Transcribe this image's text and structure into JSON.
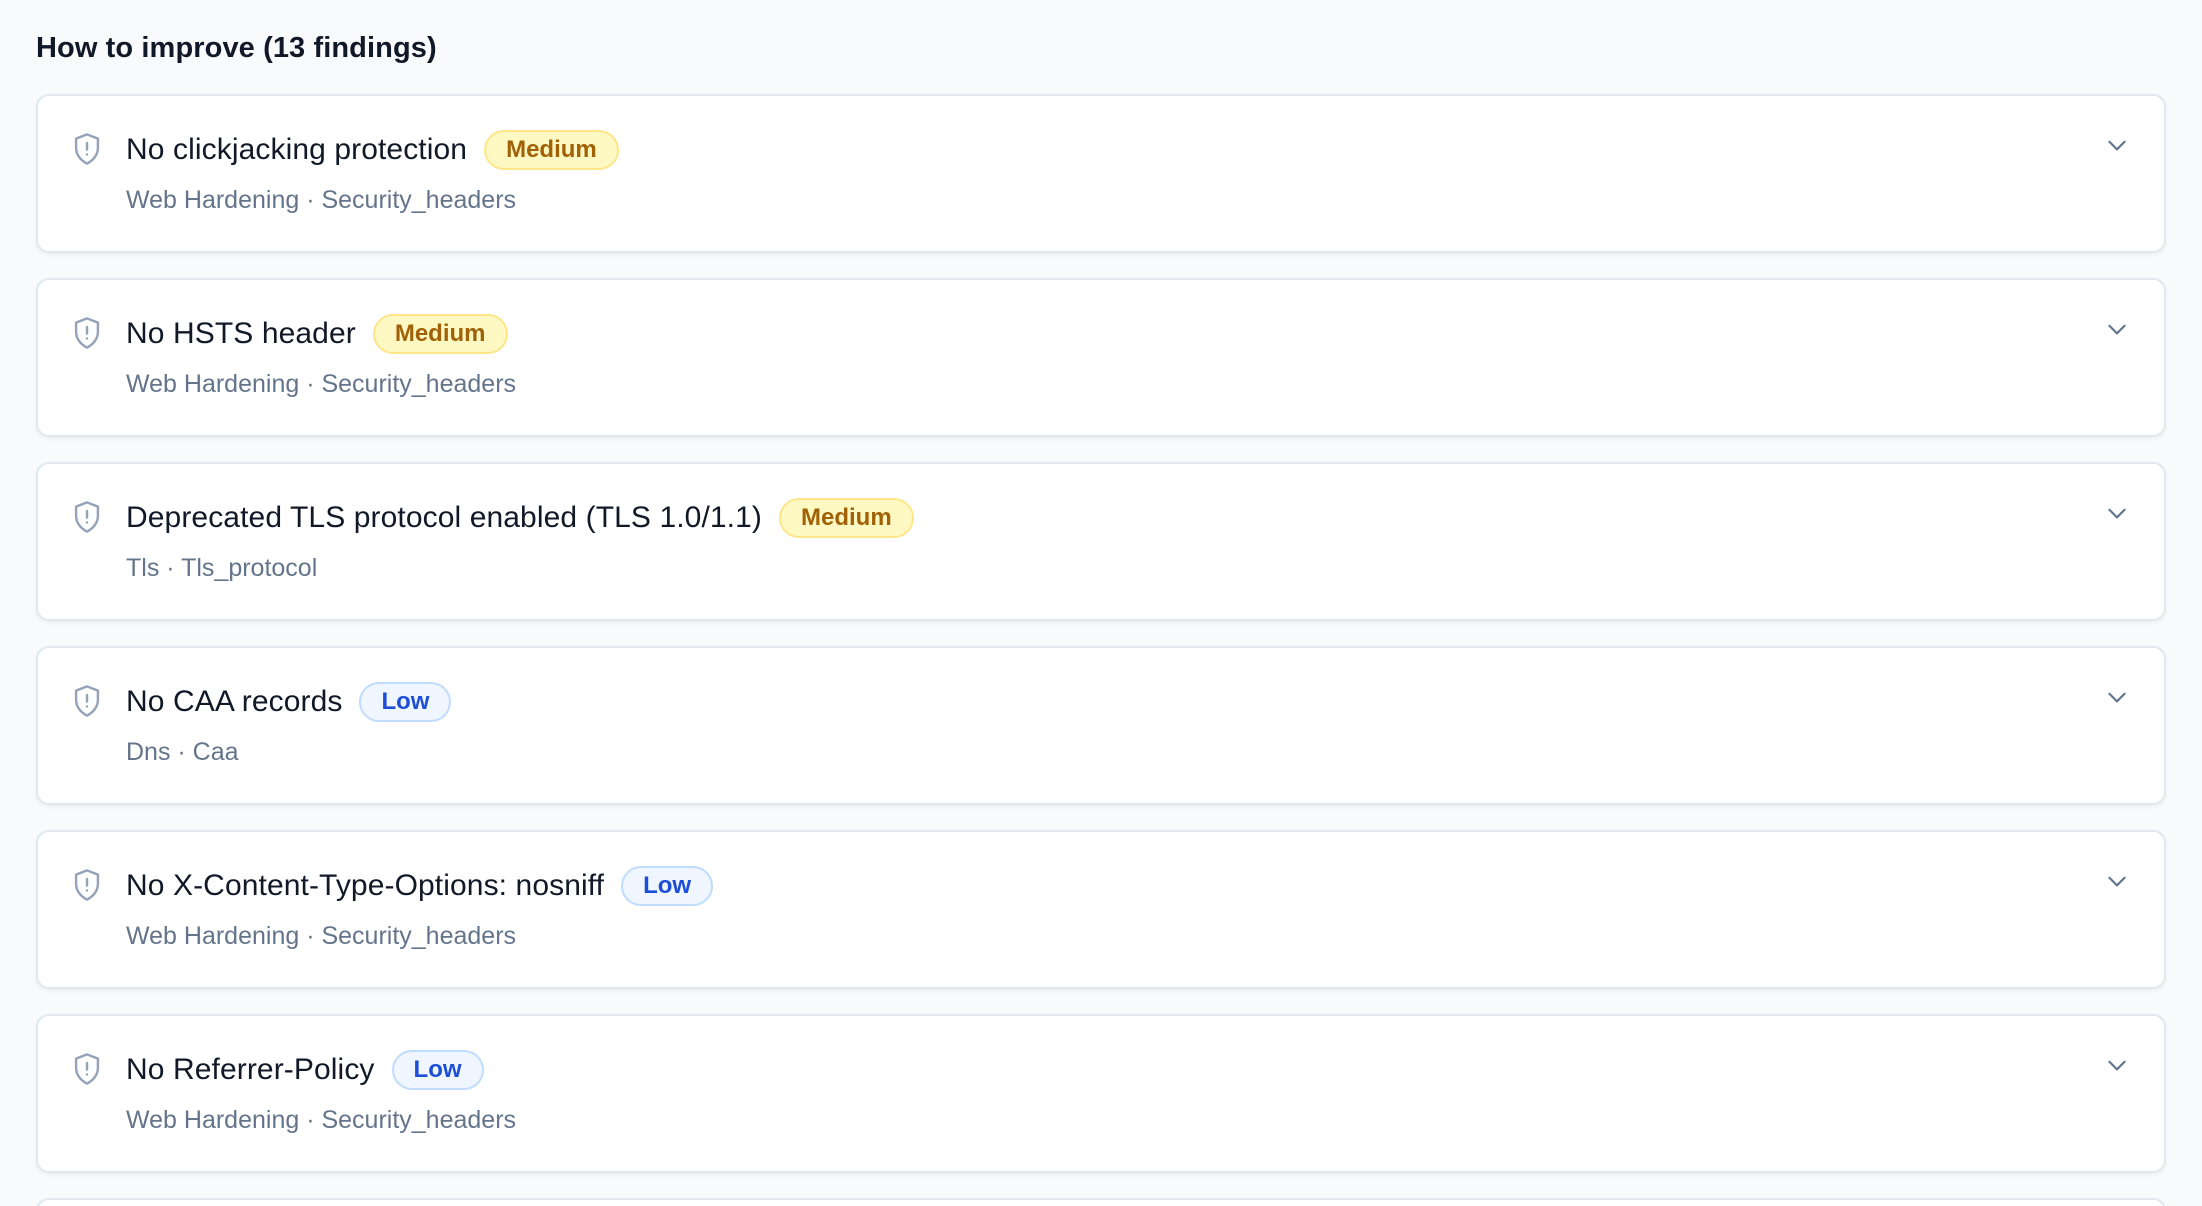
{
  "section": {
    "title": "How to improve (13 findings)"
  },
  "findings": [
    {
      "title": "No clickjacking protection",
      "severity": "Medium",
      "severity_level": "medium",
      "category": "Web Hardening · Security_headers"
    },
    {
      "title": "No HSTS header",
      "severity": "Medium",
      "severity_level": "medium",
      "category": "Web Hardening · Security_headers"
    },
    {
      "title": "Deprecated TLS protocol enabled (TLS 1.0/1.1)",
      "severity": "Medium",
      "severity_level": "medium",
      "category": "Tls · Tls_protocol"
    },
    {
      "title": "No CAA records",
      "severity": "Low",
      "severity_level": "low",
      "category": "Dns · Caa"
    },
    {
      "title": "No X-Content-Type-Options: nosniff",
      "severity": "Low",
      "severity_level": "low",
      "category": "Web Hardening · Security_headers"
    },
    {
      "title": "No Referrer-Policy",
      "severity": "Low",
      "severity_level": "low",
      "category": "Web Hardening · Security_headers"
    }
  ],
  "icons": {
    "finding": "shield-alert-icon",
    "toggle": "chevron-down-icon"
  },
  "colors": {
    "medium_text": "#a16207",
    "medium_bg": "#fef9c3",
    "low_text": "#1d4ed8",
    "low_bg": "#eff6ff"
  }
}
